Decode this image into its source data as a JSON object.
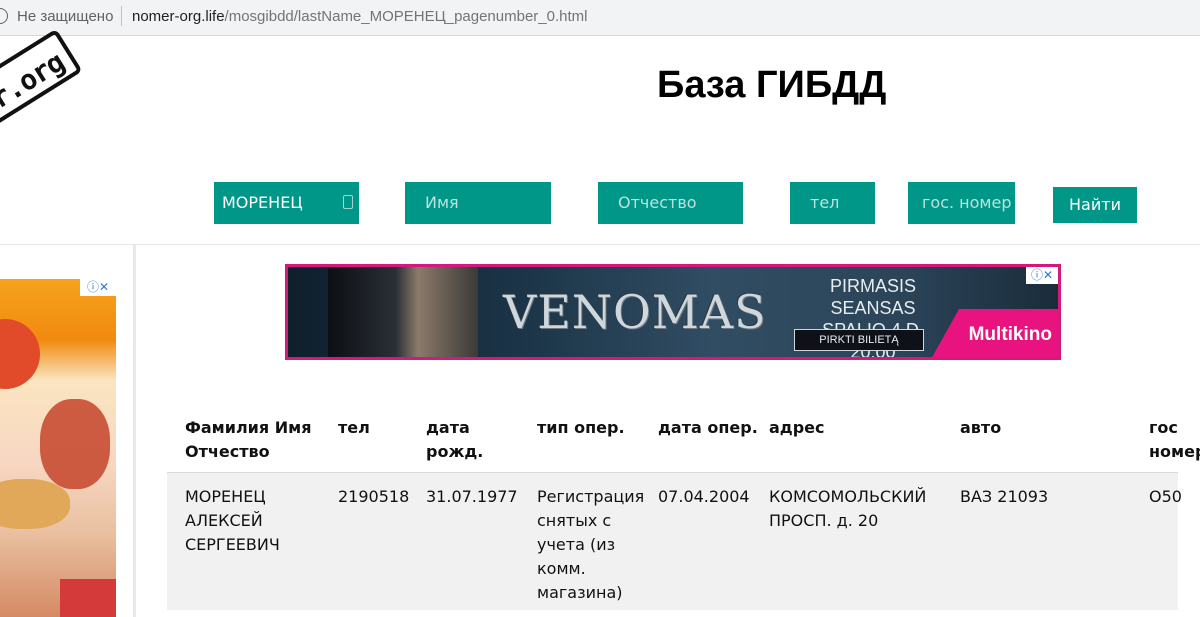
{
  "browser": {
    "security_label": "Не защищено",
    "url_host": "nomer-org.life",
    "url_path": "/mosgibdd/lastName_МОРЕНЕЦ_pagenumber_0.html"
  },
  "logo": {
    "text": "er.org"
  },
  "header": {
    "title": "База ГИБДД"
  },
  "search": {
    "last_name_value": "МОРЕНЕЦ",
    "first_name_placeholder": "Имя",
    "patronymic_placeholder": "Отчество",
    "phone_placeholder": "тел",
    "plate_placeholder": "гос. номер",
    "find_label": "Найти"
  },
  "banner_ad": {
    "title": "VENOMAS",
    "line1": "PIRMASIS SEANSAS",
    "line2": "SPALIO 4 D. 20:00",
    "button": "PIRKTI BILIETĄ",
    "brand": "Multikino",
    "badge": "ⓘ✕"
  },
  "left_ad": {
    "badge": "ⓘ✕"
  },
  "table": {
    "headers": [
      "Фамилия Имя Отчество",
      "тел",
      "дата рожд.",
      "тип опер.",
      "дата опер.",
      "адрес",
      "авто",
      "гос номер"
    ],
    "rows": [
      {
        "fio": "МОРЕНЕЦ АЛЕКСЕЙ СЕРГЕЕВИЧ",
        "phone": "2190518",
        "birth": "31.07.1977",
        "op_type": "Регистрация снятых с учета (из комм. магазина)",
        "op_date": "07.04.2004",
        "address": "КОМСОМОЛЬСКИЙ ПРОСП. д. 20",
        "car": "ВАЗ 21093",
        "plate": "О50"
      }
    ]
  },
  "colors": {
    "accent": "#009688",
    "banner_border": "#d5187b",
    "multikino": "#e8137f"
  }
}
